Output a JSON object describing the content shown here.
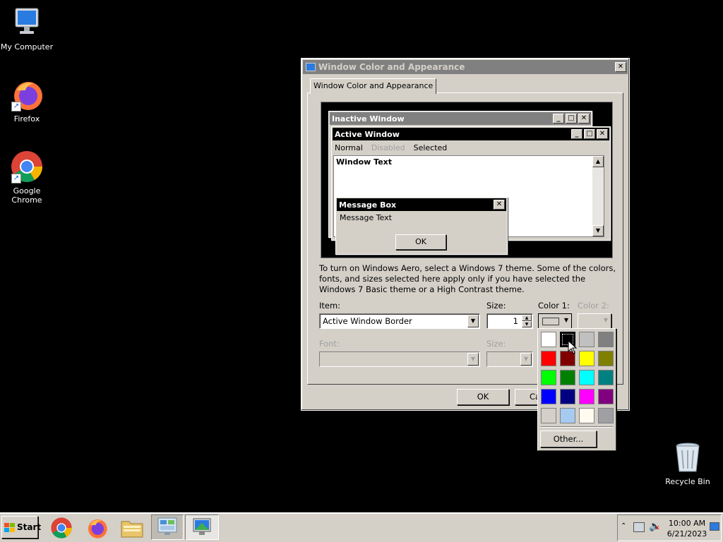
{
  "desktop": {
    "icons": [
      {
        "label": "My Computer"
      },
      {
        "label": "Firefox"
      },
      {
        "label": "Google Chrome"
      },
      {
        "label": "Recycle Bin"
      }
    ]
  },
  "dialog": {
    "title": "Window Color and Appearance",
    "tab": "Window Color and Appearance",
    "preview": {
      "inactive_title": "Inactive Window",
      "active_title": "Active Window",
      "menu": [
        "Normal",
        "Disabled",
        "Selected"
      ],
      "window_text": "Window Text",
      "msgbox_title": "Message Box",
      "msgbox_text": "Message Text",
      "msgbox_ok": "OK"
    },
    "info_text": "To turn on Windows Aero, select a Windows 7 theme.  Some of the colors, fonts, and sizes selected here apply only if you have selected the Windows 7 Basic theme or a High Contrast theme.",
    "item_label": "Item:",
    "item_value": "Active Window Border",
    "size_label": "Size:",
    "size_value": "1",
    "color1_label": "Color 1:",
    "color2_label": "Color 2:",
    "font_label": "Font:",
    "font_size_label": "Size:",
    "ok_label": "OK",
    "cancel_label": "Ca"
  },
  "color_popup": {
    "colors": [
      "#ffffff",
      "#000000",
      "#c0c0c0",
      "#808080",
      "#ff0000",
      "#800000",
      "#ffff00",
      "#808000",
      "#00ff00",
      "#008000",
      "#00ffff",
      "#008080",
      "#0000ff",
      "#000080",
      "#ff00ff",
      "#800080",
      "#d4d0c8",
      "#a6caf0",
      "#fffbf0",
      "#a0a0a4"
    ],
    "other_label": "Other..."
  },
  "taskbar": {
    "start_label": "Start",
    "time": "10:00 AM",
    "date": "6/21/2023"
  }
}
